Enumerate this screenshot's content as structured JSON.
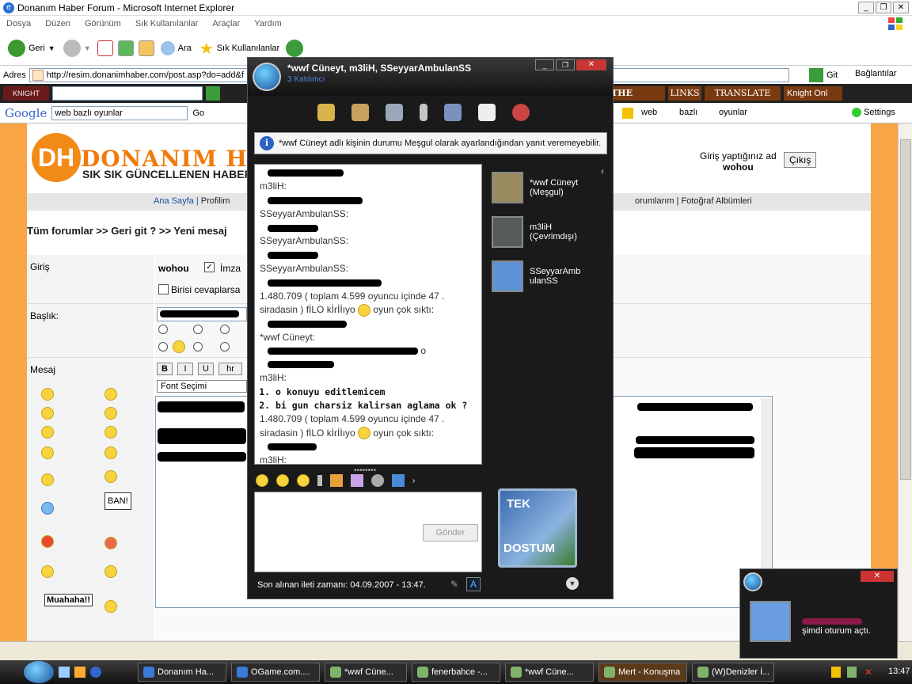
{
  "ie": {
    "title": "Donanım Haber Forum - Microsoft Internet Explorer",
    "menu": [
      "Dosya",
      "Düzen",
      "Görünüm",
      "Sık Kullanılanlar",
      "Araçlar",
      "Yardım"
    ],
    "toolbar": {
      "back": "Geri",
      "search": "Ara",
      "favorites": "Sık Kullanılanlar"
    },
    "address_label": "Adres",
    "address_url": "http://resim.donanimhaber.com/post.asp?do=add&f",
    "go": "Git",
    "links_label": "Bağlantılar",
    "links_bar": [
      "THE WEEK",
      "LINKS",
      "TRANSLATE",
      "Knight Onl"
    ],
    "google": {
      "query": "web bazlı oyunlar",
      "go": "Go",
      "chips": [
        "web",
        "bazlı",
        "oyunlar"
      ],
      "settings": "Settings"
    }
  },
  "page": {
    "logo_text": "DONANIM HABER",
    "logo_sub": "SIK SIK GÜNCELLENEN HABER SİTESİ",
    "login_text": "Giriş yaptığınız ad",
    "username": "wohou",
    "logout": "Çıkış",
    "nav": [
      "Ana Sayfa",
      "Profilim"
    ],
    "nav_right": "orumlarım | Fotoğraf Albümleri",
    "breadcrumb": "Tüm forumlar >> Geri git ? >> Yeni mesaj",
    "form": {
      "login_label": "Giriş",
      "user": "wohou",
      "signature": "İmza",
      "notify": "Birisi cevaplarsa",
      "subject_label": "Başlık:",
      "message_label": "Mesaj",
      "format_buttons": [
        "B",
        "I",
        "U",
        "hr"
      ],
      "font_select": "Font Seçimi",
      "smiley_ban": "BAN!",
      "smiley_muahaha": "Muahaha!!"
    }
  },
  "messenger": {
    "title": "*wwf  Cüneyt, m3liH, SSeyyarAmbulanSS",
    "subtitle": "3 Katılımcı",
    "info": "*wwf  Cüneyt adlı kişinin durumu Meşgul olarak ayarlandığından yanıt veremeyebilir.",
    "history": {
      "m1": "m3liH:",
      "s1": "SSeyyarAmbulanSS:",
      "s2": "SSeyyarAmbulanSS:",
      "s3": "SSeyyarAmbulanSS:",
      "stat1": "1.480.709 ( toplam 4.599 oyuncu içinde 47 .",
      "stat1b": "siradasin ) fİLO kİrİİıyo",
      "stat1c": "oyun çok sıktı:",
      "c1": "*wwf  Cüneyt:",
      "c1o": "o",
      "m2": "m3liH:",
      "li1": "o konuyu editlemicem",
      "li2": "bi gun charsiz kalirsan aglama ok ?",
      "stat2": "1.480.709 ( toplam 4.599 oyuncu içinde 47 .",
      "stat2b": "siradasin ) fİLO kİrİİıyo",
      "stat2c": "oyun çok sıktı:",
      "m3": "m3liH:"
    },
    "contacts": [
      {
        "name": "*wwf  Cüneyt",
        "status": "(Meşgul)"
      },
      {
        "name": "m3liH",
        "status": "(Çevrimdışı)"
      },
      {
        "name": "SSeyyarAmbulanSS",
        "status": ""
      }
    ],
    "send": "Gönder",
    "last_msg": "Son alınan ileti zamanı: 04.09.2007 - 13:47.",
    "tek": "TEK",
    "dostum": "DOSTUM"
  },
  "toast": {
    "text": "şimdi oturum açtı."
  },
  "taskbar": {
    "tasks": [
      "Donanım Ha...",
      "OGame.com....",
      "*wwf  Cüne...",
      "fenerbahce -...",
      "*wwf  Cüne...",
      "Mert - Konuşma",
      "(W)Denizler İ..."
    ],
    "clock": "13:47"
  }
}
